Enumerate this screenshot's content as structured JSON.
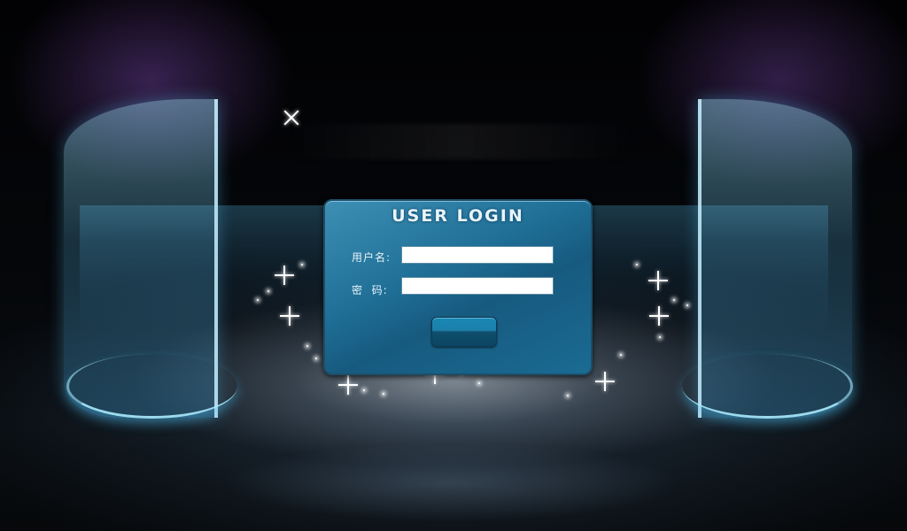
{
  "login": {
    "title": "USER LOGIN",
    "username_label": "用户名:",
    "password_label": "密  码:",
    "username_value": "",
    "password_value": "",
    "submit_label": ""
  },
  "colors": {
    "panel": "#1f6f97",
    "glass": "#5ab4dc",
    "background": "#000000"
  },
  "icons": {
    "sparkle": "sparkle-icon"
  }
}
